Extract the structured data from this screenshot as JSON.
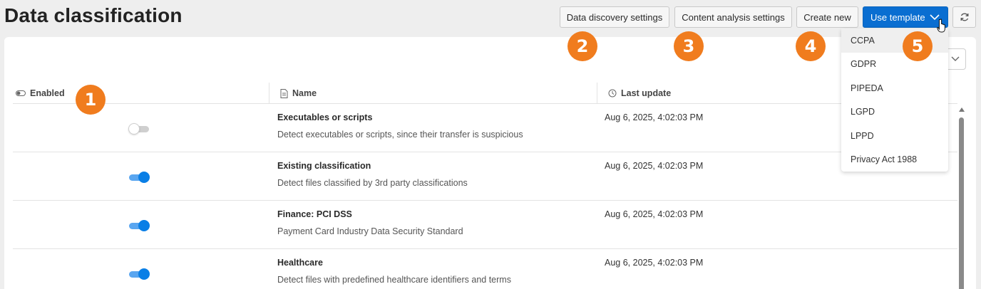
{
  "page": {
    "title": "Data classification"
  },
  "toolbar": {
    "data_discovery_label": "Data discovery settings",
    "content_analysis_label": "Content analysis settings",
    "create_new_label": "Create new",
    "use_template_label": "Use template",
    "refresh_icon": "refresh-icon"
  },
  "template_menu": {
    "items": [
      "CCPA",
      "GDPR",
      "PIPEDA",
      "LGPD",
      "LPPD",
      "Privacy Act 1988"
    ],
    "hovered": "CCPA"
  },
  "table": {
    "headers": {
      "enabled": "Enabled",
      "name": "Name",
      "last_update": "Last update"
    },
    "rows": [
      {
        "enabled": false,
        "name": "Executables or scripts",
        "description": "Detect executables or scripts, since their transfer is suspicious",
        "last_update": "Aug 6, 2025, 4:02:03 PM"
      },
      {
        "enabled": true,
        "name": "Existing classification",
        "description": "Detect files classified by 3rd party classifications",
        "last_update": "Aug 6, 2025, 4:02:03 PM"
      },
      {
        "enabled": true,
        "name": "Finance: PCI DSS",
        "description": "Payment Card Industry Data Security Standard",
        "last_update": "Aug 6, 2025, 4:02:03 PM"
      },
      {
        "enabled": true,
        "name": "Healthcare",
        "description": "Detect files with predefined healthcare identifiers and terms",
        "last_update": "Aug 6, 2025, 4:02:03 PM"
      }
    ]
  },
  "callouts": [
    "1",
    "2",
    "3",
    "4",
    "5"
  ],
  "colors": {
    "accent": "#0a6ed1",
    "callout": "#f07c1e",
    "toggle_on": "#0a7fe6"
  }
}
